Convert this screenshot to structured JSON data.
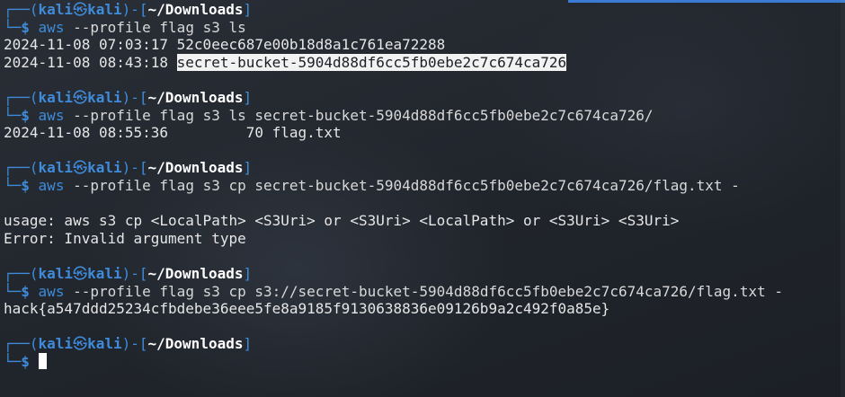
{
  "prompt": {
    "user": "kali",
    "host": "kali",
    "at_symbol": "㉿",
    "path": "~/Downloads",
    "dollar": "$",
    "top_left": "┌──(",
    "mid": ")-[",
    "top_right": "]",
    "bottom": "└─"
  },
  "blocks": [
    {
      "command_name": "aws",
      "command_args": " --profile flag s3 ls",
      "output": [
        {
          "text": "2024-11-08 07:03:17 52c0eec687e00b18d8a1c761ea72288"
        },
        {
          "prefix": "2024-11-08 08:43:18 ",
          "selected": "secret-bucket-5904d88df6cc5fb0ebe2c7c674ca726"
        }
      ],
      "blank_after": true
    },
    {
      "command_name": "aws",
      "command_args": " --profile flag s3 ls secret-bucket-5904d88df6cc5fb0ebe2c7c674ca726/",
      "output": [
        {
          "text": "2024-11-08 08:55:36         70 flag.txt"
        }
      ],
      "blank_after": true
    },
    {
      "command_name": "aws",
      "command_args": " --profile flag s3 cp secret-bucket-5904d88df6cc5fb0ebe2c7c674ca726/flag.txt -",
      "output": [
        {
          "text": ""
        },
        {
          "text": "usage: aws s3 cp <LocalPath> <S3Uri> or <S3Uri> <LocalPath> or <S3Uri> <S3Uri>"
        },
        {
          "text": "Error: Invalid argument type"
        }
      ],
      "blank_after": true
    },
    {
      "command_name": "aws",
      "command_args": " --profile flag s3 cp s3://secret-bucket-5904d88df6cc5fb0ebe2c7c674ca726/flag.txt -",
      "output": [
        {
          "text": "hack{a547ddd25234cfbdebe36eee5fe8a9185f9130638836e09126b9a2c492f0a85e}"
        }
      ],
      "blank_after": true
    }
  ],
  "colors": {
    "prompt_blue": "#3f8bd9",
    "background": "#232830",
    "selection": "#f2f2f2",
    "accent_bar": "#3b7bd3"
  }
}
